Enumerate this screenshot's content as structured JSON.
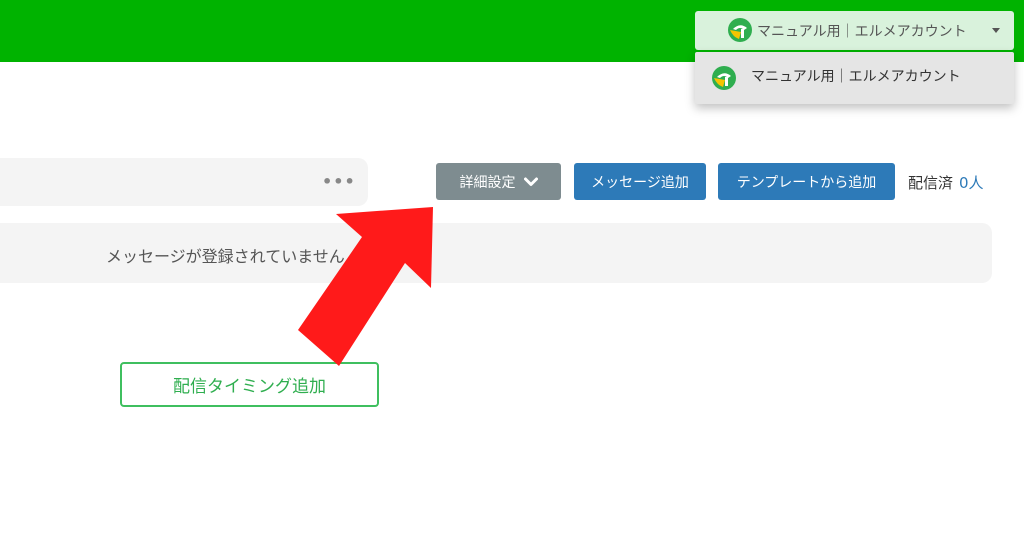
{
  "header": {
    "account_label": "マニュアル用｜エルメアカウント",
    "icons": [
      "logo-icon",
      "caret-down-icon"
    ]
  },
  "dropdown": {
    "items": [
      {
        "label": "マニュアル用｜エルメアカウント",
        "icon": "logo-icon"
      }
    ]
  },
  "toolbar": {
    "more_icon": "more-dots-icon",
    "detail_settings_label": "詳細設定",
    "detail_settings_icon": "chevron-down-icon",
    "add_message_label": "メッセージ追加",
    "add_from_template_label": "テンプレートから追加",
    "sent_label": "配信済",
    "sent_count": "0人"
  },
  "messages": {
    "empty_text": "メッセージが登録されていません"
  },
  "actions": {
    "add_timing_label": "配信タイミング追加"
  },
  "annotation": {
    "icon": "red-arrow-icon",
    "color": "#ff1a1a"
  },
  "colors": {
    "header_bg": "#00b300",
    "primary_button": "#2d7ab8",
    "secondary_button": "#7e8c90",
    "accent_green": "#3fbf5f"
  }
}
